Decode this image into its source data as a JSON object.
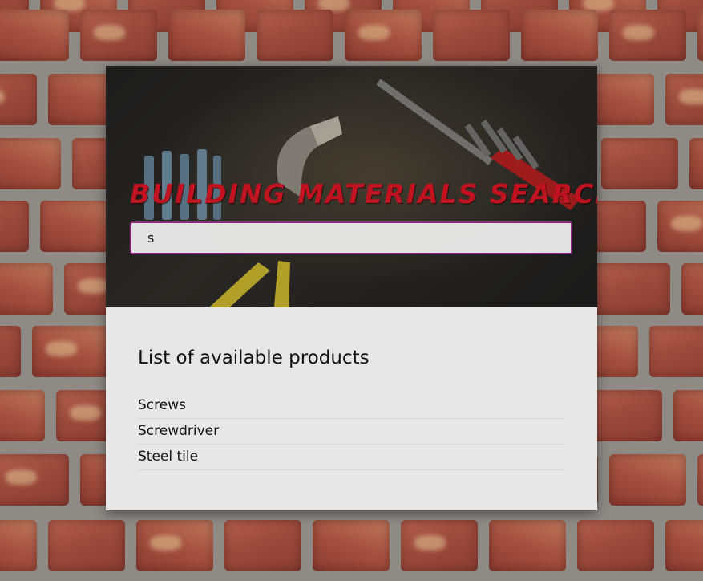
{
  "page": {
    "accent_color": "#c1121f",
    "input_border_color": "#8b2a7c"
  },
  "hero": {
    "title": "Building Materials Searcher",
    "background_icon": "tools-photo"
  },
  "search": {
    "value": "s"
  },
  "products": {
    "heading": "List of available products",
    "items": [
      {
        "label": "Screws"
      },
      {
        "label": "Screwdriver"
      },
      {
        "label": "Steel tile"
      }
    ]
  }
}
